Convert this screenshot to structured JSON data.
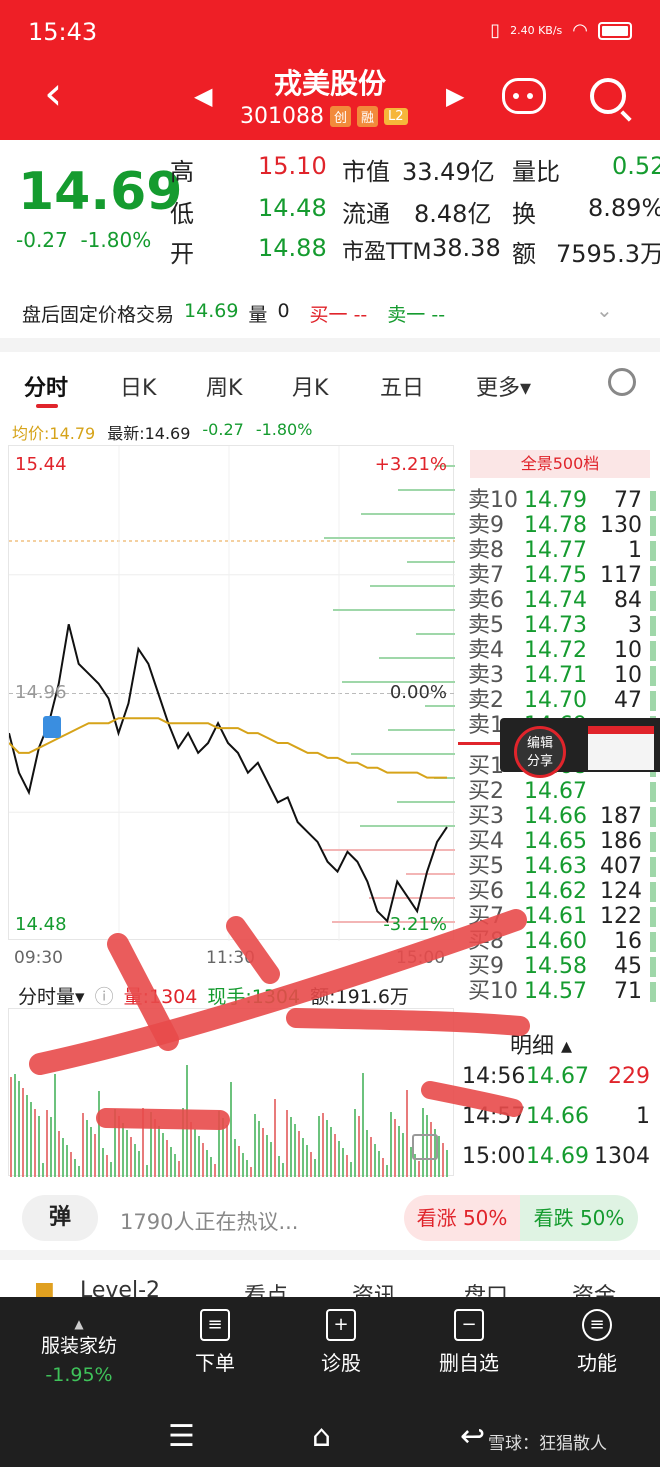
{
  "status_bar": {
    "time": "15:43",
    "speed": "2.40 KB/s"
  },
  "header": {
    "title": "戎美股份",
    "code": "301088",
    "tags": [
      "创",
      "融",
      "L2"
    ]
  },
  "quote": {
    "price": "14.69",
    "change": "-0.27",
    "change_pct": "-1.80%",
    "rows": [
      {
        "l1": "高",
        "v1": "15.10",
        "l2": "市值",
        "v2": "33.49亿",
        "l3": "量比",
        "v3": "0.52"
      },
      {
        "l1": "低",
        "v1": "14.48",
        "l2": "流通",
        "v2": "8.48亿",
        "l3": "换",
        "v3": "8.89%"
      },
      {
        "l1": "开",
        "v1": "14.88",
        "l2": "市盈TTM",
        "v2": "38.38",
        "l3": "额",
        "v3": "7595.3万"
      }
    ]
  },
  "after_hours": {
    "label": "盘后固定价格交易",
    "price": "14.69",
    "vol_label": "量",
    "vol": "0",
    "buy": "买一 --",
    "sell": "卖一 --"
  },
  "tabs": [
    "分时",
    "日K",
    "周K",
    "月K",
    "五日",
    "更多"
  ],
  "info_line": {
    "avg": "均价:14.79",
    "last": "最新:14.69",
    "chg": "-0.27",
    "pct": "-1.80%"
  },
  "chart_data": {
    "type": "line",
    "title": "",
    "x_labels": [
      "09:30",
      "11:30",
      "15:00"
    ],
    "ylim": [
      14.48,
      15.44
    ],
    "y_labels": {
      "top": "15.44",
      "mid": "14.96",
      "bottom": "14.48"
    },
    "pct_labels": {
      "top": "+3.21%",
      "mid": "0.00%",
      "bottom": "-3.21%"
    },
    "series": [
      {
        "values": [
          14.88,
          14.8,
          14.76,
          14.85,
          14.9,
          14.98,
          15.1,
          15.02,
          15.0,
          14.98,
          14.95,
          14.88,
          14.94,
          15.05,
          15.02,
          14.96,
          14.9,
          14.85,
          14.88,
          14.84,
          14.86,
          14.9,
          14.86,
          14.84,
          14.8,
          14.82,
          14.78,
          14.74,
          14.75,
          14.7,
          14.68,
          14.66,
          14.62,
          14.6,
          14.64,
          14.62,
          14.58,
          14.52,
          14.5,
          14.58,
          14.55,
          14.52,
          14.6,
          14.66,
          14.69
        ]
      },
      {
        "values": [
          14.86,
          14.84,
          14.84,
          14.85,
          14.86,
          14.87,
          14.88,
          14.89,
          14.9,
          14.9,
          14.9,
          14.91,
          14.91,
          14.91,
          14.91,
          14.91,
          14.9,
          14.9,
          14.9,
          14.9,
          14.9,
          14.89,
          14.89,
          14.89,
          14.88,
          14.88,
          14.87,
          14.86,
          14.86,
          14.85,
          14.84,
          14.84,
          14.83,
          14.83,
          14.82,
          14.82,
          14.81,
          14.81,
          14.8,
          14.8,
          14.8,
          14.8,
          14.79,
          14.79,
          14.79
        ]
      }
    ]
  },
  "order_book": {
    "header": "全景500档",
    "asks": [
      {
        "label": "卖10",
        "price": "14.79",
        "vol": "77"
      },
      {
        "label": "卖9",
        "price": "14.78",
        "vol": "130"
      },
      {
        "label": "卖8",
        "price": "14.77",
        "vol": "1"
      },
      {
        "label": "卖7",
        "price": "14.75",
        "vol": "117"
      },
      {
        "label": "卖6",
        "price": "14.74",
        "vol": "84"
      },
      {
        "label": "卖5",
        "price": "14.73",
        "vol": "3"
      },
      {
        "label": "卖4",
        "price": "14.72",
        "vol": "10"
      },
      {
        "label": "卖3",
        "price": "14.71",
        "vol": "10"
      },
      {
        "label": "卖2",
        "price": "14.70",
        "vol": "47"
      },
      {
        "label": "卖1",
        "price": "14.69",
        "vol": ""
      }
    ],
    "bids": [
      {
        "label": "买1",
        "price": "14.68",
        "vol": ""
      },
      {
        "label": "买2",
        "price": "14.67",
        "vol": ""
      },
      {
        "label": "买3",
        "price": "14.66",
        "vol": "187"
      },
      {
        "label": "买4",
        "price": "14.65",
        "vol": "186"
      },
      {
        "label": "买5",
        "price": "14.63",
        "vol": "407"
      },
      {
        "label": "买6",
        "price": "14.62",
        "vol": "124"
      },
      {
        "label": "买7",
        "price": "14.61",
        "vol": "122"
      },
      {
        "label": "买8",
        "price": "14.60",
        "vol": "16"
      },
      {
        "label": "买9",
        "price": "14.58",
        "vol": "45"
      },
      {
        "label": "买10",
        "price": "14.57",
        "vol": "71"
      }
    ]
  },
  "popup": {
    "line1": "编辑",
    "line2": "分享"
  },
  "volume": {
    "selector": "分时量",
    "vol": "量:1304",
    "hand": "现手:1304",
    "amount": "额:191.6万"
  },
  "details": {
    "header": "明细",
    "rows": [
      {
        "time": "14:56",
        "price": "14.67",
        "vol": "229"
      },
      {
        "time": "14:57",
        "price": "14.66",
        "vol": "1"
      },
      {
        "time": "15:00",
        "price": "14.69",
        "vol": "1304"
      }
    ]
  },
  "comment": {
    "button": "弹",
    "placeholder": "1790人正在热议...",
    "bull": "看涨 50%",
    "bear": "看跌 50%"
  },
  "level_tabs": [
    "Level-2",
    "看点",
    "资讯",
    "盘口",
    "资金"
  ],
  "bottom": {
    "sector_name": "服装家纺",
    "sector_pct": "-1.95%",
    "items": [
      "下单",
      "诊股",
      "删自选",
      "功能"
    ]
  },
  "watermark": "雪球：狂猖散人",
  "colors": {
    "red": "#ee1f26",
    "green": "#159b2f",
    "avg_line": "#d6a319"
  }
}
